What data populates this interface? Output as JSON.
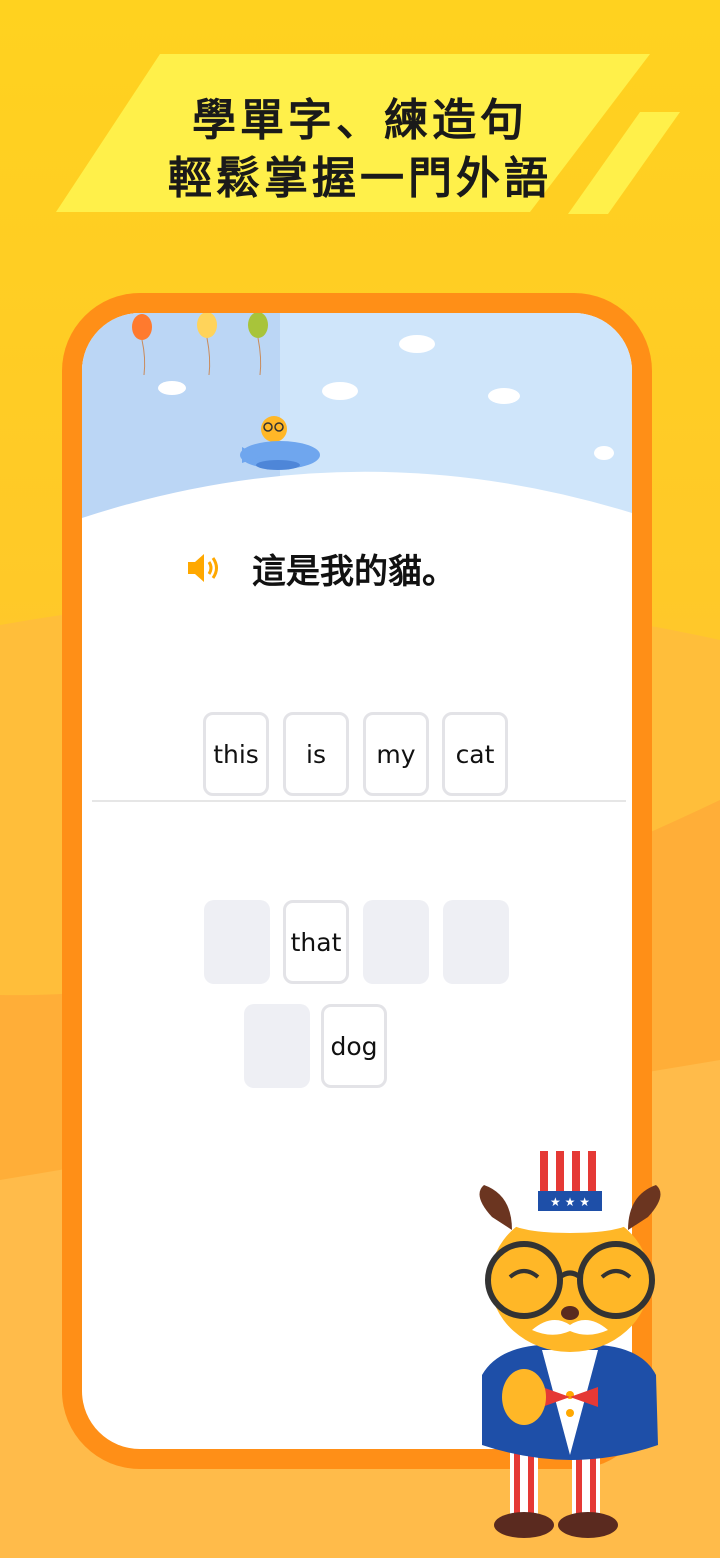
{
  "headline": {
    "line1": "學單字、練造句",
    "line2": "輕鬆掌握一門外語"
  },
  "exercise": {
    "prompt": "這是我的貓。",
    "answer_words": [
      "this",
      "is",
      "my",
      "cat"
    ],
    "word_bank": {
      "row1": [
        "",
        "that",
        "",
        ""
      ],
      "row2": [
        "",
        "dog"
      ]
    }
  },
  "colors": {
    "phone_frame": "#FF8F17",
    "background": "#FFC928",
    "banner": "#FFF04A",
    "speaker": "#FFA800"
  },
  "icons": [
    "speaker-icon",
    "balloon-icon",
    "cloud-icon",
    "airplane-icon",
    "mascot-illustration"
  ]
}
